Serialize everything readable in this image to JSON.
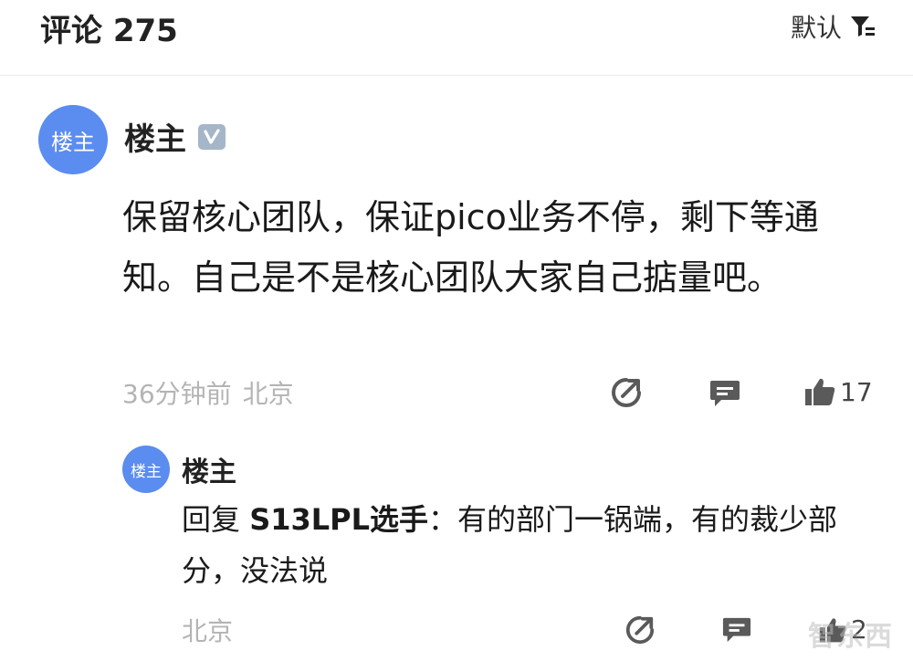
{
  "header": {
    "title": "评论 275",
    "sort_label": "默认"
  },
  "comment": {
    "avatar_text": "楼主",
    "author": "楼主",
    "badge": "V",
    "text": "保留核心团队，保证pico业务不停，剩下等通知。自己是不是核心团队大家自己掂量吧。",
    "time": "36分钟前",
    "location": "北京",
    "like_count": "17"
  },
  "reply": {
    "avatar_text": "楼主",
    "author": "楼主",
    "prefix": "回复 ",
    "target": "S13LPL选手",
    "text": "：有的部门一锅端，有的裁少部分，没法说",
    "location": "北京",
    "like_count": "2"
  },
  "watermark": "智东西",
  "icons": {
    "sort": "filter-sort-icon",
    "share": "share-arrow-icon",
    "reply": "comment-bubble-icon",
    "like": "thumbs-up-icon"
  },
  "colors": {
    "avatar": "#5b8cf0",
    "meta": "#b4b4b4",
    "badge": "#a5b6c9"
  }
}
